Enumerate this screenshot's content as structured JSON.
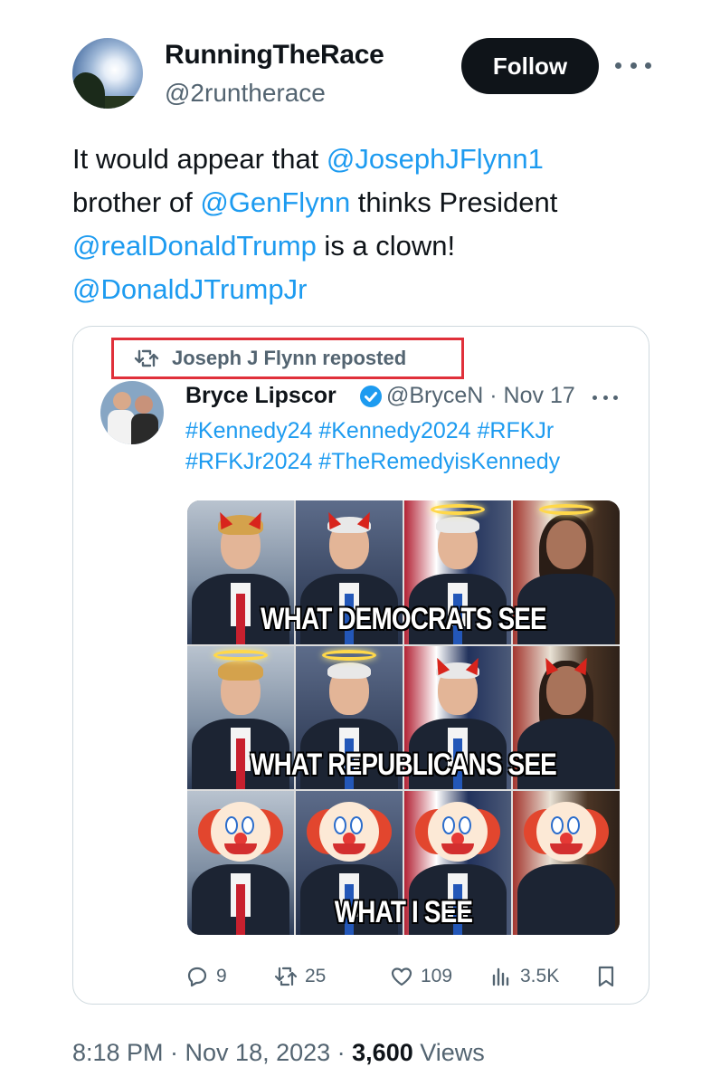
{
  "author": {
    "display_name": "RunningTheRace",
    "handle": "@2runtherace",
    "follow_label": "Follow"
  },
  "tweet": {
    "text_parts": {
      "t1": "It would appear that ",
      "m1": "@JosephJFlynn1",
      "t2": "brother of ",
      "m2": "@GenFlynn",
      "t3": " thinks  President",
      "m3": "@realDonaldTrump",
      "t4": " is a clown!",
      "m4": "@DonaldJTrumpJr"
    }
  },
  "quote": {
    "repost_label": "Joseph J Flynn reposted",
    "author_name": "Bryce Lipscor",
    "author_handle_date": "@BryceN · Nov 17",
    "hashtags_line1": "#Kennedy24 #Kennedy2024 #RFKJr",
    "hashtags_line2": "#RFKJr2024 #TheRemedyisKennedy",
    "meme_captions": [
      "WHAT DEMOCRATS SEE",
      "WHAT REPUBLICANS SEE",
      "WHAT I SEE"
    ],
    "actions": {
      "replies": "9",
      "reposts": "25",
      "likes": "109",
      "views": "3.5K"
    }
  },
  "footer": {
    "time_date": "8:18 PM · Nov 18, 2023 · ",
    "views_count": "3,600",
    "views_label": " Views"
  },
  "colors": {
    "link": "#1d9bf0",
    "highlight_box": "#e0303a",
    "text_secondary": "#536471"
  }
}
